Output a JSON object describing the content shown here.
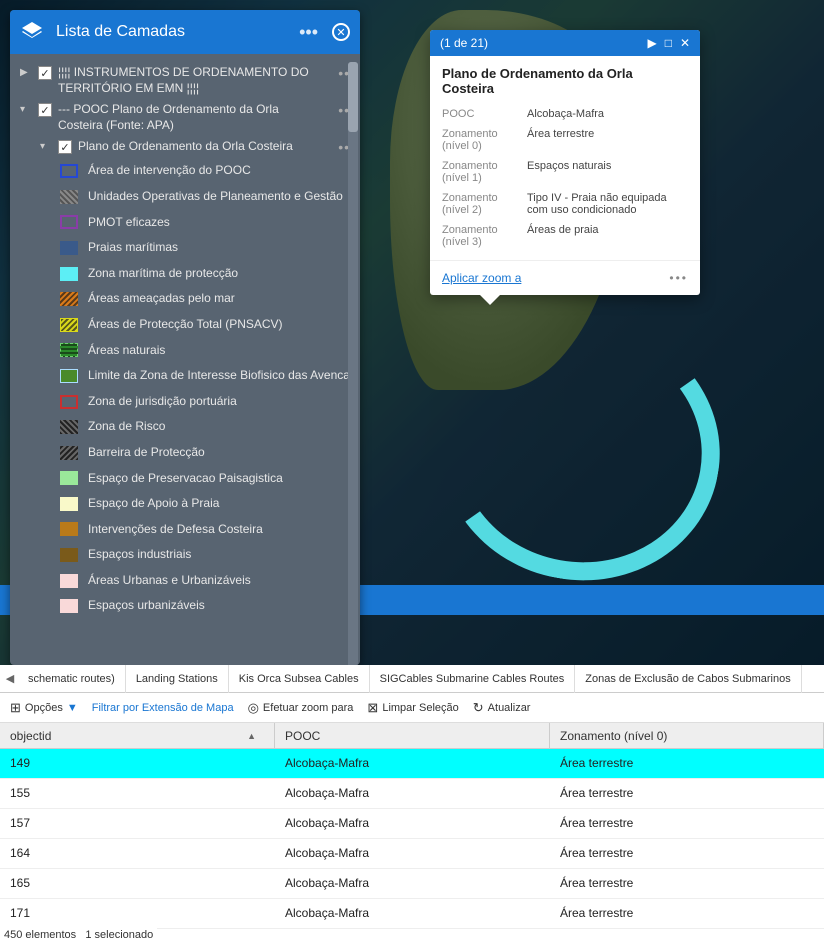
{
  "layer_panel": {
    "title": "Lista de Camadas",
    "tree": {
      "item0": {
        "label": "¦¦¦¦ INSTRUMENTOS DE ORDENAMENTO DO TERRITÓRIO EM EMN ¦¦¦¦"
      },
      "item1": {
        "label": "--- POOC Plano de Ordenamento da Orla Costeira (Fonte: APA)"
      },
      "item2": {
        "label": "Plano de Ordenamento da Orla Costeira"
      }
    },
    "legend": [
      {
        "label": "Área de intervenção do POOC",
        "cls": "sw-outline-blue"
      },
      {
        "label": "Unidades Operativas de Planeamento e Gestão",
        "cls": "sw-hatch-gray"
      },
      {
        "label": "PMOT eficazes",
        "cls": "sw-outline-purple"
      },
      {
        "label": "Praias marítimas",
        "cls": "sw-dots-blue"
      },
      {
        "label": "Zona marítima de protecção",
        "cls": "sw-cyan"
      },
      {
        "label": "Áreas ameaçadas pelo mar",
        "cls": "sw-hatch-orange"
      },
      {
        "label": "Áreas de Protecção Total (PNSACV)",
        "cls": "sw-hatch-yellow"
      },
      {
        "label": "Áreas naturais",
        "cls": "sw-pattern-green"
      },
      {
        "label": "Limite da Zona de Interesse Biofisico das Avencas",
        "cls": "sw-lime-pattern"
      },
      {
        "label": "Zona de jurisdição portuária",
        "cls": "sw-outline-red"
      },
      {
        "label": "Zona de Risco",
        "cls": "sw-hatch-black"
      },
      {
        "label": "Barreira de Protecção",
        "cls": "sw-hatch-black2"
      },
      {
        "label": "Espaço de Preservacao Paisagistica",
        "cls": "sw-lightgreen"
      },
      {
        "label": "Espaço de Apoio à Praia",
        "cls": "sw-lightyellow"
      },
      {
        "label": "Intervenções de Defesa Costeira",
        "cls": "sw-brown1"
      },
      {
        "label": "Espaços industriais",
        "cls": "sw-brown2"
      },
      {
        "label": "Áreas Urbanas e Urbanizáveis",
        "cls": "sw-pink"
      },
      {
        "label": "Espaços urbanizáveis",
        "cls": "sw-pink2"
      }
    ]
  },
  "popup": {
    "counter": "(1 de 21)",
    "title": "Plano de Ordenamento da Orla Costeira",
    "rows": [
      {
        "key": "POOC",
        "val": "Alcobaça-Mafra"
      },
      {
        "key": "Zonamento (nível 0)",
        "val": "Área terrestre"
      },
      {
        "key": "Zonamento (nível 1)",
        "val": "Espaços naturais"
      },
      {
        "key": "Zonamento (nível 2)",
        "val": "Tipo IV - Praia não equipada com uso condicionado"
      },
      {
        "key": "Zonamento (nível 3)",
        "val": "Áreas de praia"
      }
    ],
    "zoom": "Aplicar zoom a"
  },
  "tabs": [
    "schematic routes)",
    "Landing Stations",
    "Kis Orca Subsea Cables",
    "SIGCables Submarine Cables Routes",
    "Zonas de Exclusão de Cabos Submarinos"
  ],
  "toolbar": {
    "options": "Opções",
    "filter": "Filtrar por Extensão de Mapa",
    "zoom": "Efetuar zoom para",
    "clear": "Limpar Seleção",
    "refresh": "Atualizar"
  },
  "grid": {
    "headers": {
      "id": "objectid",
      "pooc": "POOC",
      "zon": "Zonamento (nível 0)"
    },
    "rows": [
      {
        "id": "149",
        "pooc": "Alcobaça-Mafra",
        "zon": "Área terrestre",
        "sel": true
      },
      {
        "id": "155",
        "pooc": "Alcobaça-Mafra",
        "zon": "Área terrestre",
        "sel": false
      },
      {
        "id": "157",
        "pooc": "Alcobaça-Mafra",
        "zon": "Área terrestre",
        "sel": false
      },
      {
        "id": "164",
        "pooc": "Alcobaça-Mafra",
        "zon": "Área terrestre",
        "sel": false
      },
      {
        "id": "165",
        "pooc": "Alcobaça-Mafra",
        "zon": "Área terrestre",
        "sel": false
      },
      {
        "id": "171",
        "pooc": "Alcobaça-Mafra",
        "zon": "Área terrestre",
        "sel": false
      }
    ]
  },
  "status": {
    "count": "450 elementos",
    "selected": "1 selecionado"
  }
}
